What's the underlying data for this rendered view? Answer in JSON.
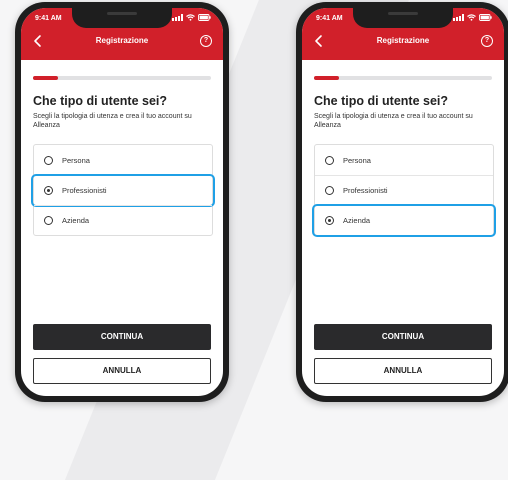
{
  "screens": [
    {
      "status_time": "9:41 AM",
      "nav_title": "Registrazione",
      "help_glyph": "?",
      "progress": 0.14,
      "title": "Che tipo di utente sei?",
      "subtitle": "Scegli la tipologia di utenza e crea il tuo account su Alleanza",
      "options": [
        {
          "label": "Persona",
          "selected": false
        },
        {
          "label": "Professionisti",
          "selected": true
        },
        {
          "label": "Azienda",
          "selected": false
        }
      ],
      "continue_label": "CONTINUA",
      "cancel_label": "ANNULLA"
    },
    {
      "status_time": "9:41 AM",
      "nav_title": "Registrazione",
      "help_glyph": "?",
      "progress": 0.14,
      "title": "Che tipo di utente sei?",
      "subtitle": "Scegli la tipologia di utenza e crea il tuo account su Alleanza",
      "options": [
        {
          "label": "Persona",
          "selected": false
        },
        {
          "label": "Professionisti",
          "selected": false
        },
        {
          "label": "Azienda",
          "selected": true
        }
      ],
      "continue_label": "CONTINUA",
      "cancel_label": "ANNULLA"
    }
  ],
  "colors": {
    "brand_red": "#d1202a",
    "highlight_blue": "#1fa0e6",
    "button_dark": "#2a2a2c"
  },
  "icons": {
    "back": "chevron-left-icon",
    "help": "help-circle-icon",
    "signal": "signal-icon",
    "wifi": "wifi-icon",
    "battery": "battery-icon",
    "radio_on": "radio-checked-icon",
    "radio_off": "radio-unchecked-icon"
  }
}
